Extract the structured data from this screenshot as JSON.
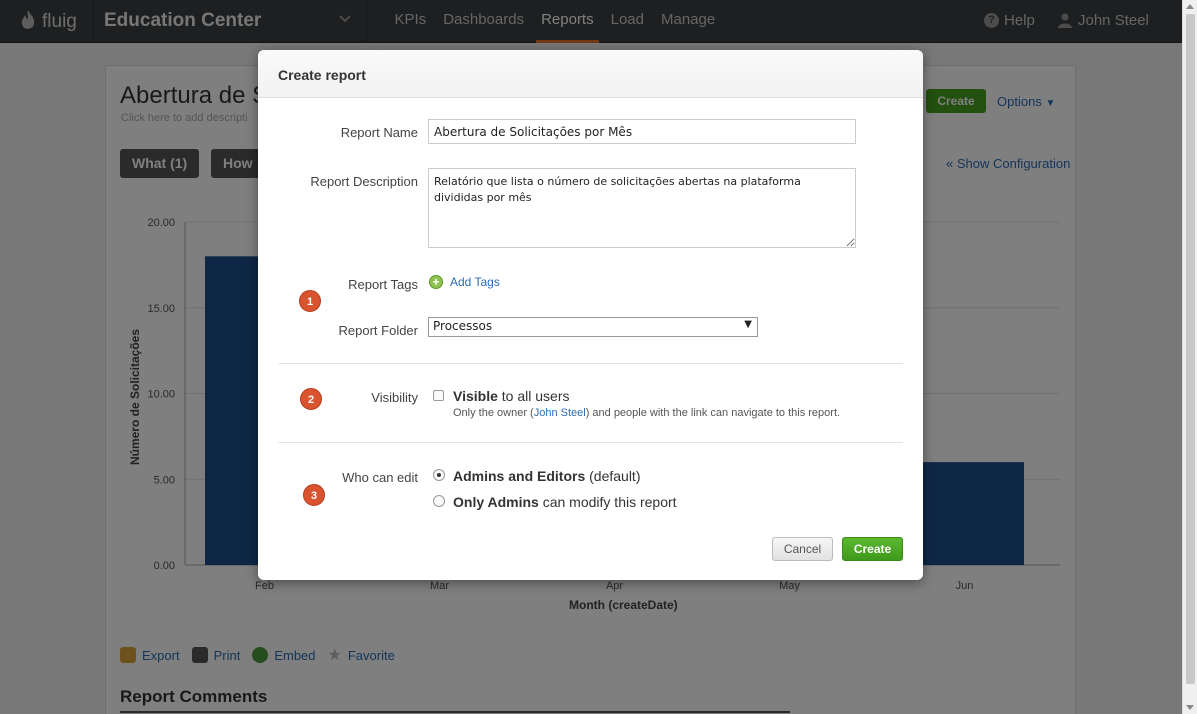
{
  "topbar": {
    "logo_text": "fluig",
    "app_title": "Education Center",
    "nav": [
      "KPIs",
      "Dashboards",
      "Reports",
      "Load",
      "Manage"
    ],
    "active_nav": "Reports",
    "help_label": "Help",
    "user_name": "John Steel"
  },
  "page": {
    "report_title": "Abertura de S",
    "report_subtitle": "Click here to add descripti",
    "what_button": "What (1)",
    "how_button": "How",
    "create_button": "Create",
    "options_label": "Options",
    "show_config": "« Show Configuration",
    "actions": [
      "Export",
      "Print",
      "Embed",
      "Favorite"
    ],
    "comments_title": "Report Comments"
  },
  "chart_data": {
    "type": "bar",
    "categories": [
      "Feb",
      "Mar",
      "Apr",
      "May",
      "Jun"
    ],
    "values": [
      18,
      null,
      null,
      null,
      6
    ],
    "ylabel": "Número de Solicitações",
    "xlabel": "Month (createDate)",
    "yticks": [
      "0.00",
      "5.00",
      "10.00",
      "15.00",
      "20.00"
    ],
    "ylim": [
      0,
      20
    ],
    "grid": true,
    "bar_color": "#1f4e8c"
  },
  "modal": {
    "title": "Create report",
    "name_label": "Report Name",
    "name_value": "Abertura de Solicitações por Mês",
    "description_label": "Report Description",
    "description_value": "Relatório que lista o número de solicitações abertas na plataforma divididas por mês",
    "tags_label": "Report Tags",
    "add_tags": "Add Tags",
    "folder_label": "Report Folder",
    "folder_value": "Processos",
    "visibility_label": "Visibility",
    "visible_bold": "Visible",
    "visible_rest": " to all users",
    "vis_note_pre": "Only the owner (",
    "vis_note_owner": "John Steel",
    "vis_note_post": ") and people with the link can navigate to this report.",
    "edit_label": "Who can edit",
    "option1_bold": "Admins and Editors",
    "option1_rest": " (default)",
    "option2_bold": "Only Admins",
    "option2_rest": " can modify this report",
    "cancel": "Cancel",
    "create": "Create",
    "badges": [
      "1",
      "2",
      "3"
    ]
  }
}
